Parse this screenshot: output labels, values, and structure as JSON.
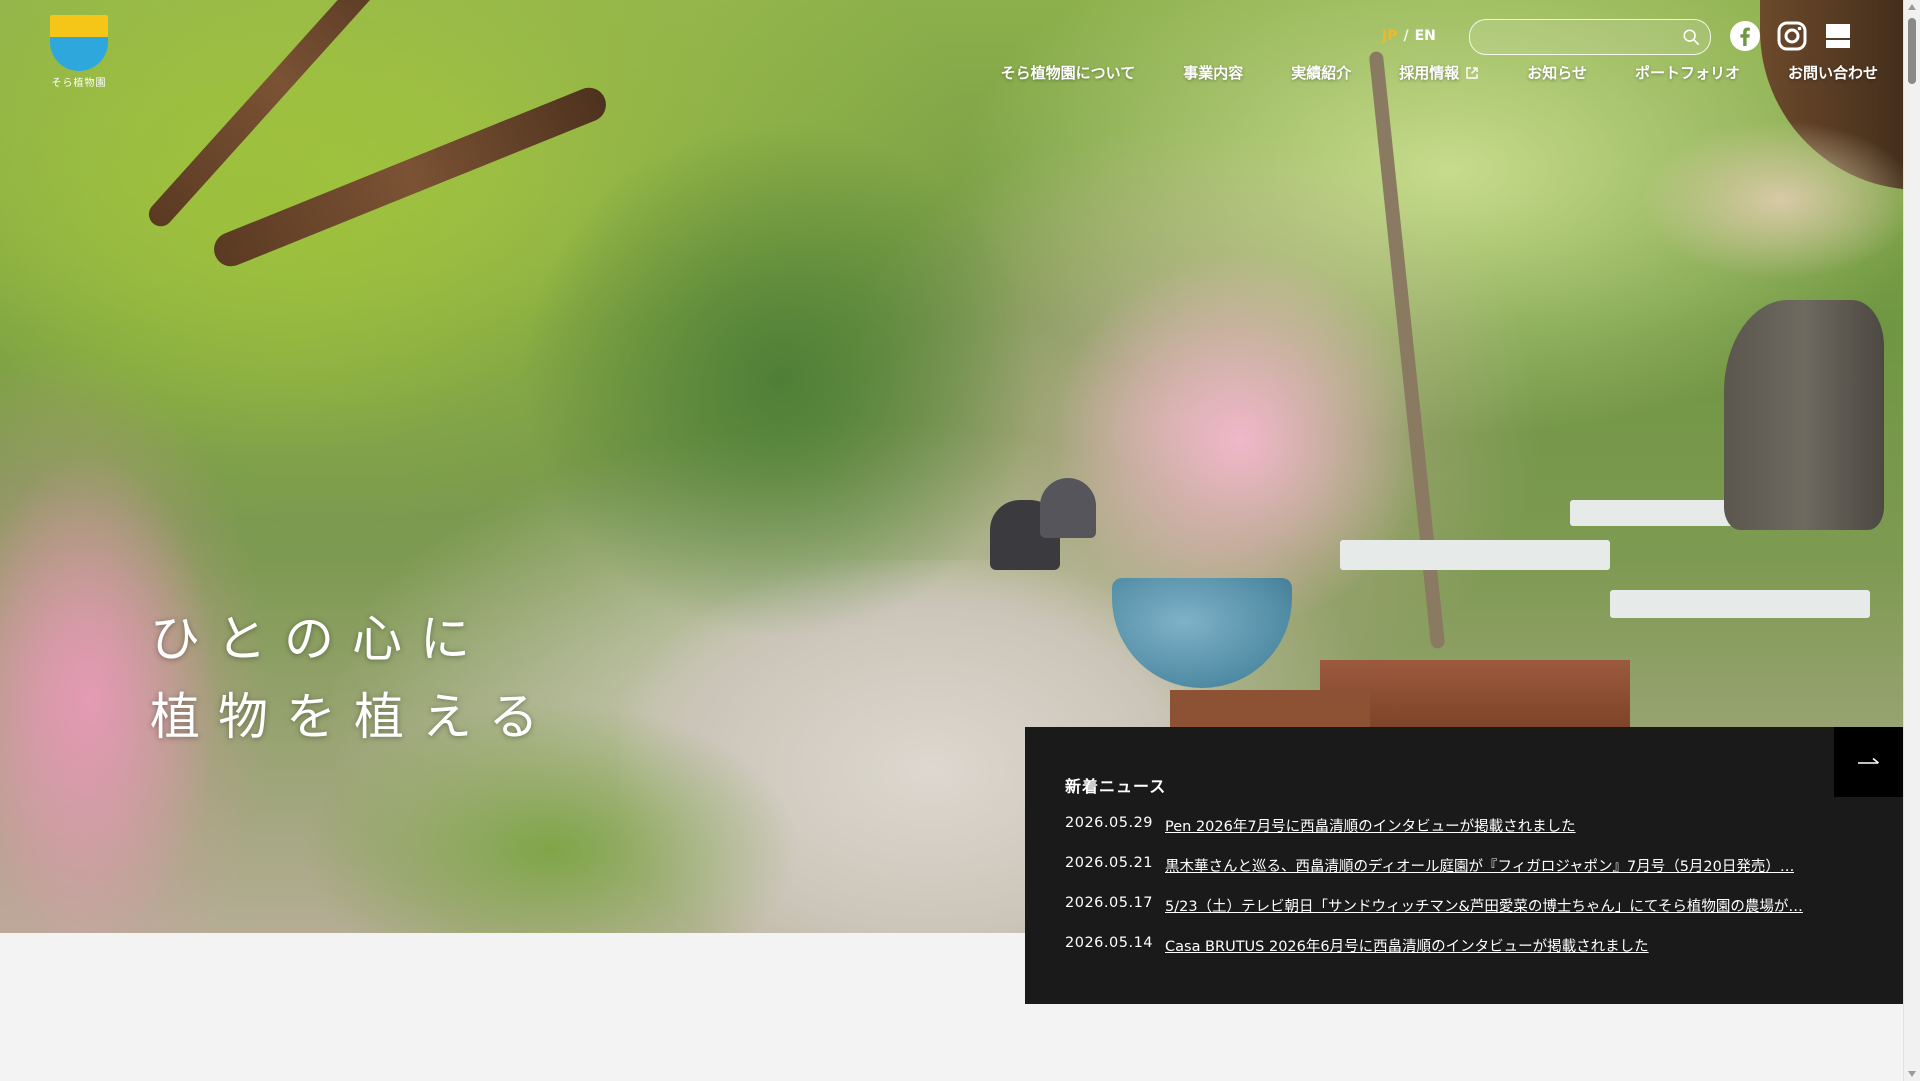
{
  "site": {
    "logo_text": "そら植物園",
    "colors": {
      "accent_lang": "#f0b82b",
      "news_bg": "#1a1a1a",
      "logo_yellow": "#f5c518",
      "logo_blue": "#2ea7dc"
    }
  },
  "header": {
    "lang": {
      "jp": "JP",
      "separator": "/",
      "en": "EN"
    },
    "search": {
      "placeholder": "",
      "icon": "search-icon"
    },
    "social": [
      "facebook-icon",
      "instagram-icon",
      "flag-icon"
    ],
    "nav": [
      {
        "label": "そら植物園について"
      },
      {
        "label": "事業内容"
      },
      {
        "label": "実績紹介"
      },
      {
        "label": "採用情報",
        "icon": "external-link-icon"
      },
      {
        "label": "お知らせ"
      },
      {
        "label": "ポートフォリオ"
      },
      {
        "label": "お問い合わせ"
      }
    ]
  },
  "hero": {
    "tagline_line1": "ひとの心に",
    "tagline_line2": "植物を植える"
  },
  "news": {
    "title": "新着ニュース",
    "more_icon": "arrow-right-icon",
    "items": [
      {
        "date": "2026.05.29",
        "text": "Pen 2026年7月号に西畠清順のインタビューが掲載されました"
      },
      {
        "date": "2026.05.21",
        "text": "黒木華さんと巡る、西畠清順のディオール庭園が『フィガロジャポン』7月号（5月20日発売）…"
      },
      {
        "date": "2026.05.17",
        "text": "5/23（土）テレビ朝日「サンドウィッチマン&芦田愛菜の博士ちゃん」にてそら植物園の農場が…"
      },
      {
        "date": "2026.05.14",
        "text": "Casa BRUTUS 2026年6月号に西畠清順のインタビューが掲載されました"
      }
    ]
  }
}
